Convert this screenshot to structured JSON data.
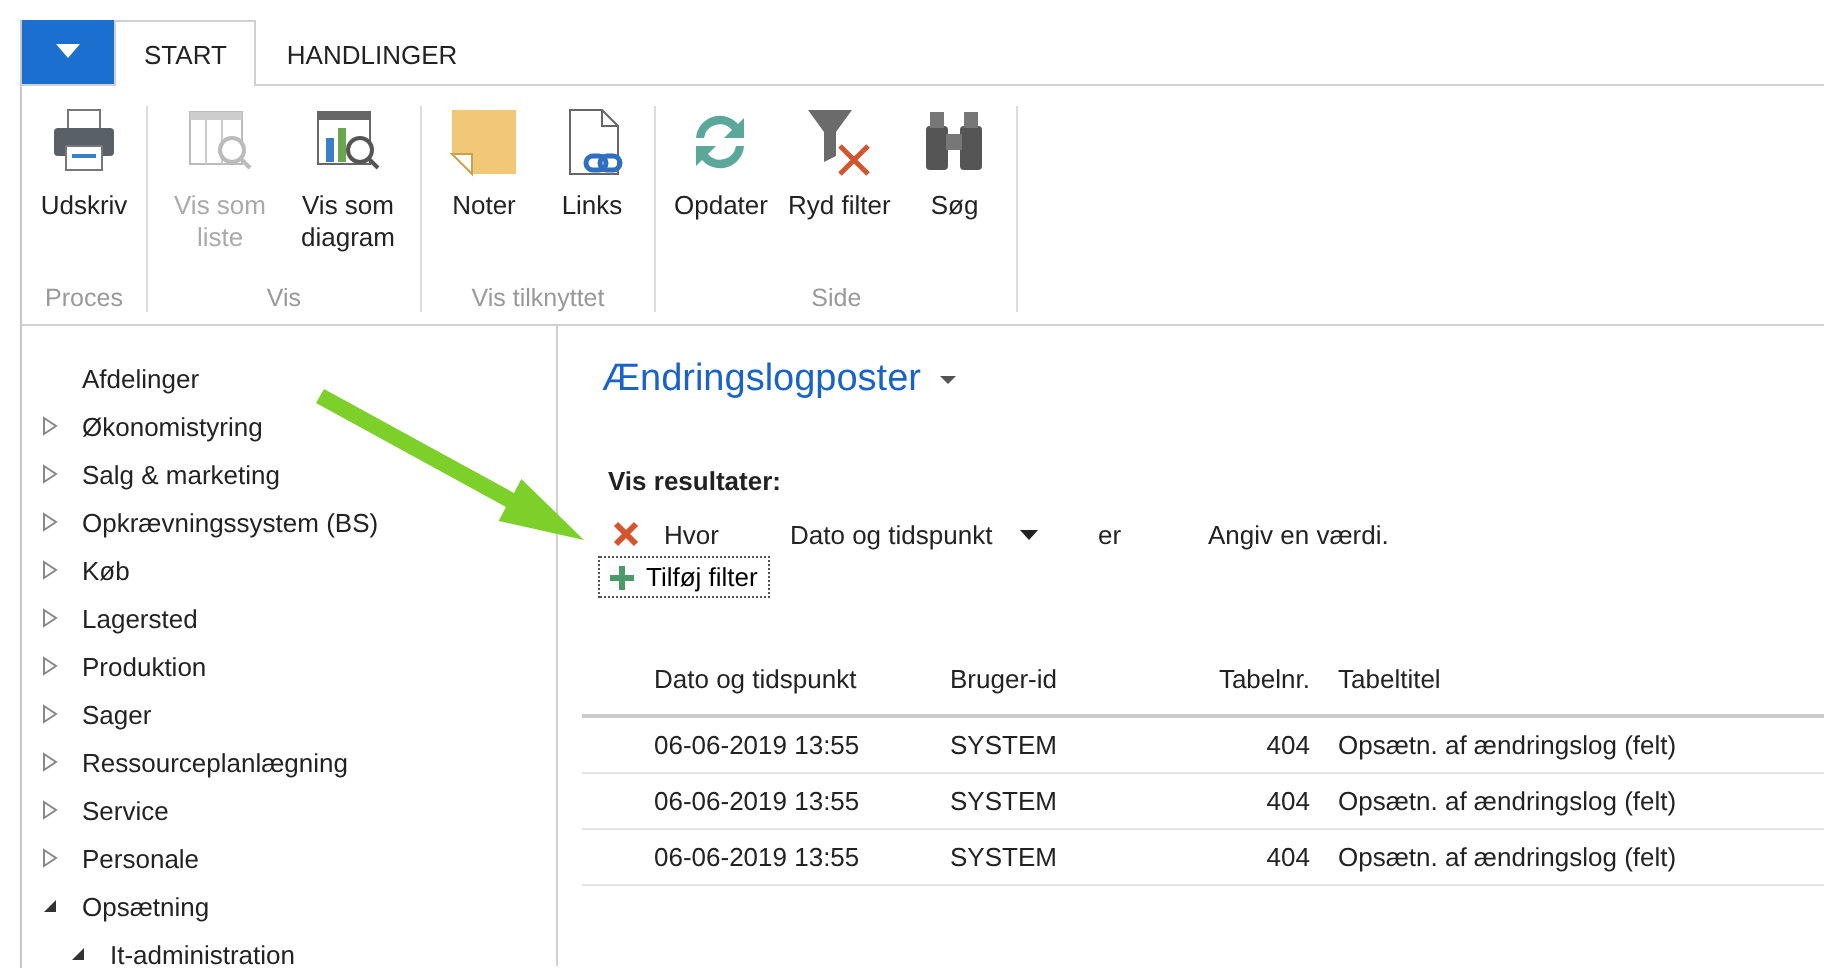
{
  "ribbon": {
    "tabs": [
      {
        "label": "START",
        "selected": true
      },
      {
        "label": "HANDLINGER",
        "selected": false
      }
    ],
    "groups": [
      {
        "label": "Proces",
        "buttons": [
          {
            "label": "Udskriv",
            "kind": "printer",
            "disabled": false
          }
        ]
      },
      {
        "label": "Vis",
        "buttons": [
          {
            "label": "Vis som liste",
            "kind": "list",
            "disabled": true
          },
          {
            "label": "Vis som diagram",
            "kind": "chart",
            "disabled": false
          }
        ]
      },
      {
        "label": "Vis tilknyttet",
        "buttons": [
          {
            "label": "Noter",
            "kind": "note",
            "disabled": false
          },
          {
            "label": "Links",
            "kind": "link",
            "disabled": false
          }
        ]
      },
      {
        "label": "Side",
        "buttons": [
          {
            "label": "Opdater",
            "kind": "refresh",
            "disabled": false
          },
          {
            "label": "Ryd filter",
            "kind": "clearfilter",
            "disabled": false
          },
          {
            "label": "Søg",
            "kind": "binoculars",
            "disabled": false
          }
        ]
      }
    ]
  },
  "navigation": {
    "items": [
      {
        "label": "Afdelinger"
      },
      {
        "label": "Økonomistyring",
        "expanded": false
      },
      {
        "label": "Salg & marketing",
        "expanded": false
      },
      {
        "label": "Opkrævningssystem (BS)",
        "expanded": false
      },
      {
        "label": "Køb",
        "expanded": false
      },
      {
        "label": "Lagersted",
        "expanded": false
      },
      {
        "label": "Produktion",
        "expanded": false
      },
      {
        "label": "Sager",
        "expanded": false
      },
      {
        "label": "Ressourceplanlægning",
        "expanded": false
      },
      {
        "label": "Service",
        "expanded": false
      },
      {
        "label": "Personale",
        "expanded": false
      },
      {
        "label": "Opsætning",
        "expanded": true,
        "children": [
          {
            "label": "It-administration",
            "expanded": true
          }
        ]
      }
    ]
  },
  "page": {
    "title": "Ændringslogposter",
    "filter": {
      "heading": "Vis resultater:",
      "where": "Hvor",
      "field": "Dato og tidspunkt",
      "operator": "er",
      "value_placeholder": "Angiv en værdi.",
      "add_label": "Tilføj filter"
    },
    "table": {
      "columns": [
        "Dato og tidspunkt",
        "Bruger-id",
        "Tabelnr.",
        "Tabeltitel"
      ],
      "rows": [
        [
          "06-06-2019 13:55",
          "SYSTEM",
          "404",
          "Opsætn. af ændringslog (felt)"
        ],
        [
          "06-06-2019 13:55",
          "SYSTEM",
          "404",
          "Opsætn. af ændringslog (felt)"
        ],
        [
          "06-06-2019 13:55",
          "SYSTEM",
          "404",
          "Opsætn. af ændringslog (felt)"
        ]
      ]
    }
  }
}
